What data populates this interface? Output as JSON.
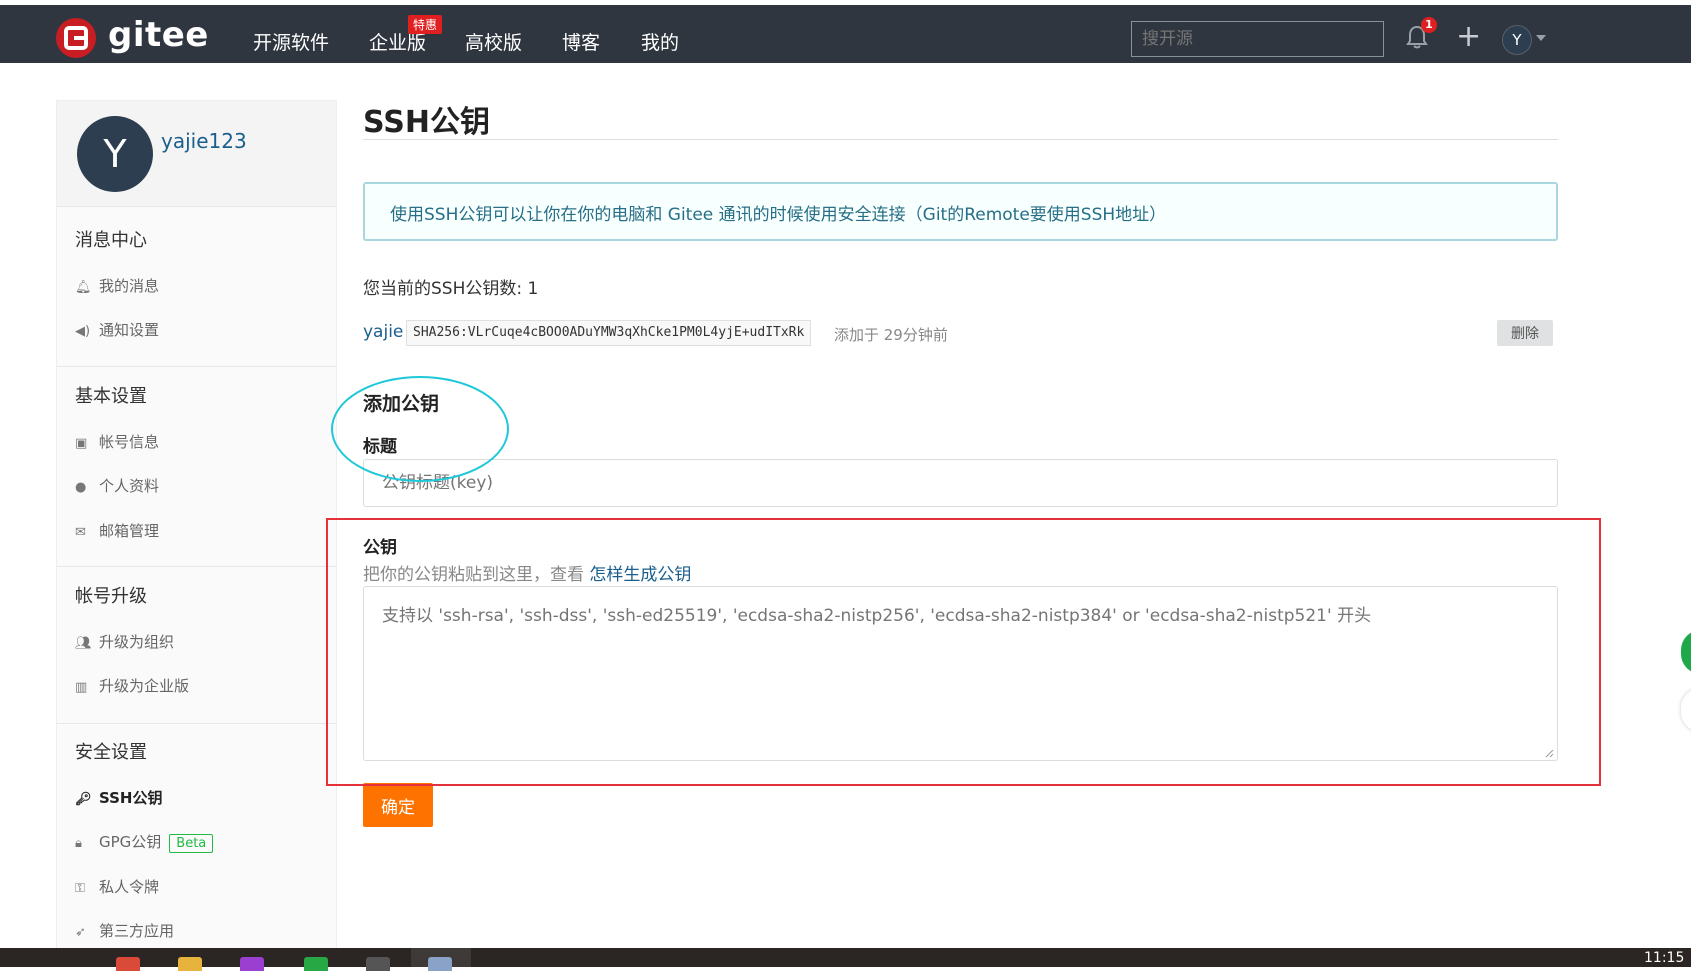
{
  "nav": {
    "logo_text": "gitee",
    "items": [
      {
        "label": "开源软件"
      },
      {
        "label": "企业版"
      },
      {
        "label": "高校版"
      },
      {
        "label": "博客"
      },
      {
        "label": "我的"
      }
    ],
    "enterprise_badge": "特惠",
    "search_placeholder": "搜开源",
    "notification_count": "1",
    "user_initial": "Y"
  },
  "sidebar": {
    "avatar_initial": "Y",
    "username": "yajie123",
    "sections": [
      {
        "title": "消息中心",
        "items": [
          {
            "label": "我的消息",
            "icon": "bell-icon"
          },
          {
            "label": "通知设置",
            "icon": "volume-icon"
          }
        ]
      },
      {
        "title": "基本设置",
        "items": [
          {
            "label": "帐号信息",
            "icon": "id-card-icon"
          },
          {
            "label": "个人资料",
            "icon": "user-icon"
          },
          {
            "label": "邮箱管理",
            "icon": "mail-icon"
          }
        ]
      },
      {
        "title": "帐号升级",
        "items": [
          {
            "label": "升级为组织",
            "icon": "users-icon"
          },
          {
            "label": "升级为企业版",
            "icon": "building-icon"
          }
        ]
      },
      {
        "title": "安全设置",
        "items": [
          {
            "label": "SSH公钥",
            "icon": "key-icon",
            "active": true
          },
          {
            "label": "GPG公钥",
            "icon": "lock-icon",
            "badge": "Beta"
          },
          {
            "label": "私人令牌",
            "icon": "token-icon"
          },
          {
            "label": "第三方应用",
            "icon": "rocket-icon"
          }
        ]
      }
    ]
  },
  "main": {
    "title": "SSH公钥",
    "info": "使用SSH公钥可以让你在你的电脑和 Gitee 通讯的时候使用安全连接（Git的Remote要使用SSH地址）",
    "key_count_text": "您当前的SSH公钥数: 1",
    "keys": [
      {
        "name": "yajie",
        "fingerprint": "SHA256:VLrCuqe4cBOO0ADuYMW3qXhCke1PM0L4yjE+udITxRk",
        "added": "添加于 29分钟前",
        "delete_label": "删除"
      }
    ],
    "add_title": "添加公钥",
    "title_label": "标题",
    "title_placeholder": "公钥标题(key)",
    "key_label": "公钥",
    "key_hint": "把你的公钥粘贴到这里，查看",
    "key_hint_link": "怎样生成公钥",
    "key_placeholder": "支持以 'ssh-rsa', 'ssh-dss', 'ssh-ed25519', 'ecdsa-sha2-nistp256', 'ecdsa-sha2-nistp384' or 'ecdsa-sha2-nistp521' 开头",
    "submit_label": "确定"
  },
  "colors": {
    "nav_bg": "#2f3640",
    "brand_red": "#c71d23",
    "submit_orange": "#fe7300",
    "info_text": "#276f86",
    "annotation_cyan": "#1ec8d8",
    "annotation_red": "#e5323a"
  },
  "taskbar": {
    "clock": "11:15"
  }
}
